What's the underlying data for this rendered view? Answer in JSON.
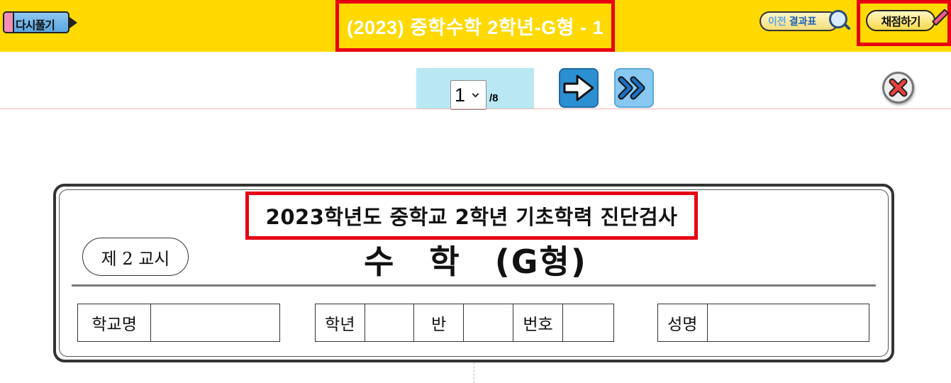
{
  "topbar": {
    "retry_label": "다시풀기",
    "title": "(2023) 중학수학 2학년-G형 - 1",
    "prev_result_part1": "이전",
    "prev_result_part2": "결과표",
    "grade_label": "채점하기"
  },
  "nav": {
    "current_page": "1",
    "total_pages": "/8"
  },
  "exam": {
    "title": "2023학년도 중학교 2학년 기초학력 진단검사",
    "period": "제 2 교시",
    "subject": "수 학 (G형)",
    "fields": {
      "school_label": "학교명",
      "grade_label": "학년",
      "class_label": "반",
      "number_label": "번호",
      "name_label": "성명"
    }
  },
  "colors": {
    "topbar_bg": "#ffd900",
    "highlight_red": "#e60012",
    "page_panel_bg": "#b9e8f2",
    "next_button": "#2b8fd2",
    "last_button": "#86c8f0"
  },
  "icons": {
    "next": "arrow-right-icon",
    "last": "double-chevron-right-icon",
    "close": "close-x-icon",
    "search": "magnifier-icon",
    "pencil": "pencil-icon"
  }
}
